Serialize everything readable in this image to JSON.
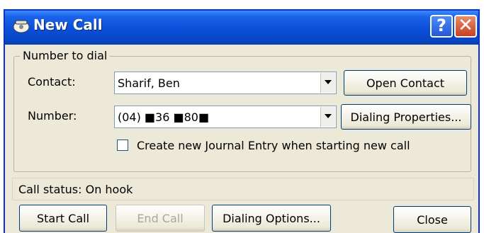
{
  "window": {
    "title": "New Call",
    "help_label": "?",
    "close_label": "✕"
  },
  "group": {
    "label": "Number to dial"
  },
  "contact": {
    "label": "Contact:",
    "value": "Sharif, Ben"
  },
  "number": {
    "label": "Number:",
    "value": "(04) ■36 ■80■"
  },
  "buttons": {
    "open_contact": "Open Contact",
    "dialing_properties": "Dialing Properties...",
    "start_call": "Start Call",
    "end_call": "End Call",
    "dialing_options": "Dialing Options...",
    "close": "Close"
  },
  "journal": {
    "label": "Create new Journal Entry when starting new call",
    "checked": false
  },
  "status": {
    "text": "Call status: On hook"
  },
  "icons": {
    "app": "phone-icon"
  },
  "colors": {
    "titlebar": "#0a4fd8",
    "face": "#ece9d8",
    "close_button": "#c8401e"
  }
}
